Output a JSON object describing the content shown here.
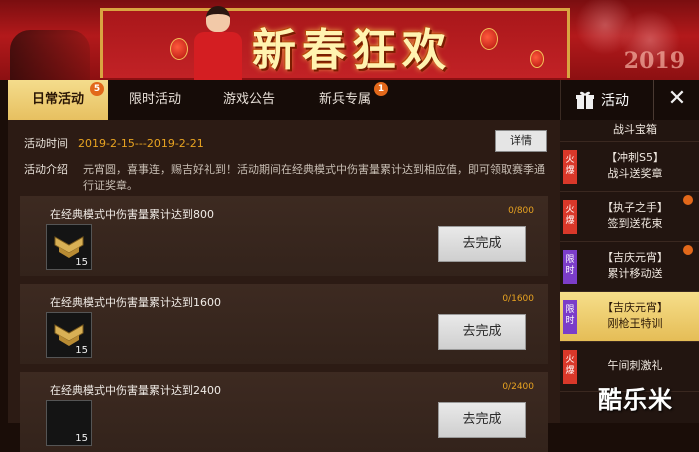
{
  "banner": {
    "title": "新春狂欢",
    "year": "2019"
  },
  "tabs": [
    {
      "label": "日常活动",
      "badge": "5",
      "active": true
    },
    {
      "label": "限时活动",
      "badge": "",
      "active": false
    },
    {
      "label": "游戏公告",
      "badge": "",
      "active": false
    },
    {
      "label": "新兵专属",
      "badge": "1",
      "active": false
    }
  ],
  "activity": {
    "time_label": "活动时间",
    "time_value": "2019-2-15---2019-2-21",
    "detail_btn": "详情",
    "intro_label": "活动介绍",
    "intro_text": "元宵圆，喜事连，赐吉好礼到！活动期间在经典模式中伤害量累计达到相应值，即可领取赛季通行证奖章。"
  },
  "tasks": [
    {
      "title": "在经典模式中伤害量累计达到800",
      "progress": "0/800",
      "reward_count": "15",
      "button": "去完成"
    },
    {
      "title": "在经典模式中伤害量累计达到1600",
      "progress": "0/1600",
      "reward_count": "15",
      "button": "去完成"
    },
    {
      "title": "在经典模式中伤害量累计达到2400",
      "progress": "0/2400",
      "reward_count": "15",
      "button": "去完成"
    }
  ],
  "sidebar": {
    "header": "活动",
    "close": "✕",
    "items": [
      {
        "tag": "",
        "tag_type": "",
        "line1": "战斗宝箱",
        "line2": ""
      },
      {
        "tag": "火爆",
        "tag_type": "hot",
        "line1": "【冲刺S5】",
        "line2": "战斗送奖章"
      },
      {
        "tag": "火爆",
        "tag_type": "hot",
        "line1": "【执子之手】",
        "line2": "签到送花束"
      },
      {
        "tag": "限时",
        "tag_type": "limit",
        "line1": "【吉庆元宵】",
        "line2": "累计移动送"
      },
      {
        "tag": "限时",
        "tag_type": "limit",
        "line1": "【吉庆元宵】",
        "line2": "刚枪王特训"
      },
      {
        "tag": "火爆",
        "tag_type": "hot",
        "line1": "午间刺激礼",
        "line2": ""
      }
    ]
  },
  "watermark": "酷乐米",
  "colors": {
    "accent_gold": "#e7c060",
    "progress_orange": "#e8a321",
    "badge_orange": "#e2681a"
  }
}
